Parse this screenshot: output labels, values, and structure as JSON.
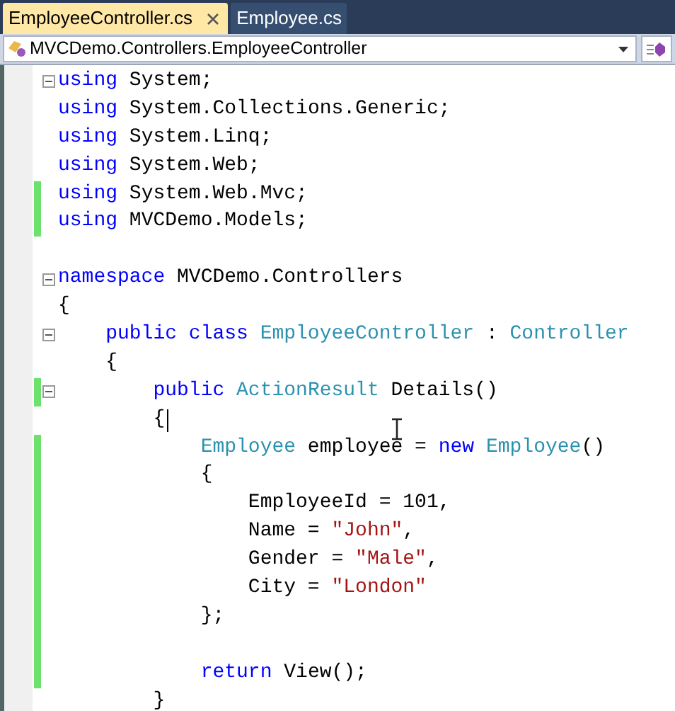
{
  "tabs": [
    {
      "label": "EmployeeController.cs",
      "selected": true,
      "closable": true
    },
    {
      "label": "Employee.cs",
      "selected": false,
      "closable": false
    }
  ],
  "navigation": {
    "type_dropdown": "MVCDemo.Controllers.EmployeeController"
  },
  "code_lines": [
    {
      "changed": false,
      "collapsible": true,
      "tokens": [
        {
          "kind": "keyword",
          "text": "using"
        },
        {
          "kind": "plain",
          "text": " System;"
        }
      ]
    },
    {
      "changed": false,
      "collapsible": false,
      "tokens": [
        {
          "kind": "keyword",
          "text": "using"
        },
        {
          "kind": "plain",
          "text": " System.Collections.Generic;"
        }
      ]
    },
    {
      "changed": false,
      "collapsible": false,
      "tokens": [
        {
          "kind": "keyword",
          "text": "using"
        },
        {
          "kind": "plain",
          "text": " System.Linq;"
        }
      ]
    },
    {
      "changed": false,
      "collapsible": false,
      "tokens": [
        {
          "kind": "keyword",
          "text": "using"
        },
        {
          "kind": "plain",
          "text": " System.Web;"
        }
      ]
    },
    {
      "changed": true,
      "collapsible": false,
      "tokens": [
        {
          "kind": "keyword",
          "text": "using"
        },
        {
          "kind": "plain",
          "text": " System.Web.Mvc;"
        }
      ]
    },
    {
      "changed": true,
      "collapsible": false,
      "tokens": [
        {
          "kind": "keyword",
          "text": "using"
        },
        {
          "kind": "plain",
          "text": " MVCDemo.Models;"
        }
      ]
    },
    {
      "changed": false,
      "collapsible": false
    },
    {
      "changed": false,
      "collapsible": true,
      "tokens": [
        {
          "kind": "keyword",
          "text": "namespace"
        },
        {
          "kind": "plain",
          "text": " MVCDemo.Controllers"
        }
      ]
    },
    {
      "changed": false,
      "collapsible": false,
      "tokens": [
        {
          "kind": "plain",
          "text": "{"
        }
      ]
    },
    {
      "changed": false,
      "collapsible": true,
      "tokens": [
        {
          "kind": "keyword",
          "text": "    public class "
        },
        {
          "kind": "type",
          "text": "EmployeeController"
        },
        {
          "kind": "plain",
          "text": " : "
        },
        {
          "kind": "type",
          "text": "Controller"
        }
      ]
    },
    {
      "changed": false,
      "collapsible": false,
      "tokens": [
        {
          "kind": "plain",
          "text": "    {"
        }
      ]
    },
    {
      "changed": true,
      "collapsible": true,
      "tokens": [
        {
          "kind": "keyword",
          "text": "        public "
        },
        {
          "kind": "type",
          "text": "ActionResult"
        },
        {
          "kind": "plain",
          "text": " Details()"
        }
      ]
    },
    {
      "changed": false,
      "collapsible": false,
      "caret": true,
      "tokens": [
        {
          "kind": "plain",
          "text": "        {"
        }
      ]
    },
    {
      "changed": true,
      "collapsible": false,
      "tokens": [
        {
          "kind": "type",
          "text": "            Employee"
        },
        {
          "kind": "plain",
          "text": " employee = "
        },
        {
          "kind": "keyword",
          "text": "new "
        },
        {
          "kind": "type",
          "text": "Employee"
        },
        {
          "kind": "plain",
          "text": "()"
        }
      ]
    },
    {
      "changed": true,
      "collapsible": false,
      "tokens": [
        {
          "kind": "plain",
          "text": "            {"
        }
      ]
    },
    {
      "changed": true,
      "collapsible": false,
      "tokens": [
        {
          "kind": "plain",
          "text": "                EmployeeId = 101,"
        }
      ]
    },
    {
      "changed": true,
      "collapsible": false,
      "tokens": [
        {
          "kind": "plain",
          "text": "                Name = "
        },
        {
          "kind": "string",
          "text": "\"John\""
        },
        {
          "kind": "plain",
          "text": ","
        }
      ]
    },
    {
      "changed": true,
      "collapsible": false,
      "tokens": [
        {
          "kind": "plain",
          "text": "                Gender = "
        },
        {
          "kind": "string",
          "text": "\"Male\""
        },
        {
          "kind": "plain",
          "text": ","
        }
      ]
    },
    {
      "changed": true,
      "collapsible": false,
      "tokens": [
        {
          "kind": "plain",
          "text": "                City = "
        },
        {
          "kind": "string",
          "text": "\"London\""
        }
      ]
    },
    {
      "changed": true,
      "collapsible": false,
      "tokens": [
        {
          "kind": "plain",
          "text": "            };"
        }
      ]
    },
    {
      "changed": true,
      "collapsible": false
    },
    {
      "changed": true,
      "collapsible": false,
      "tokens": [
        {
          "kind": "keyword",
          "text": "            return"
        },
        {
          "kind": "plain",
          "text": " View();"
        }
      ]
    },
    {
      "changed": false,
      "collapsible": false,
      "tokens": [
        {
          "kind": "plain",
          "text": "        }"
        }
      ]
    }
  ]
}
